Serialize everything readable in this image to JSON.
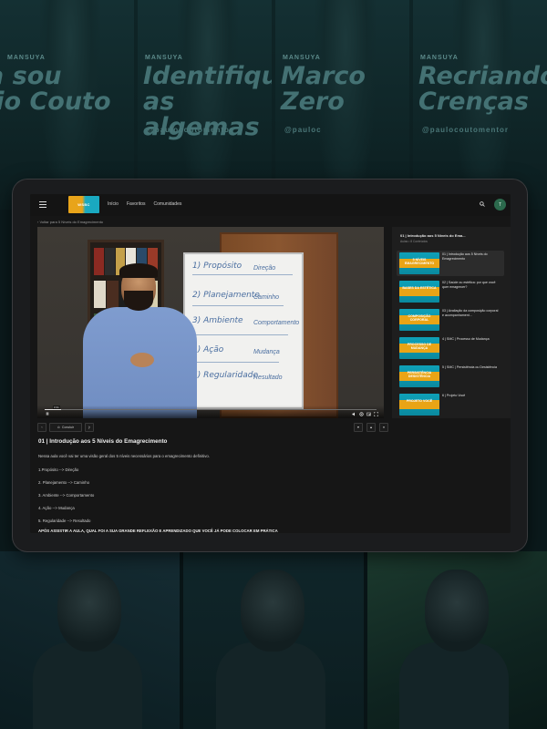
{
  "background": {
    "posters": [
      {
        "kicker": "MANSUYA",
        "title": "a sou\nlio Couto",
        "handle": ""
      },
      {
        "kicker": "MANSUYA",
        "title": "Identifique\nas algemas",
        "handle": "@paulocoutomentor"
      },
      {
        "kicker": "MANSUYA",
        "title": "Marco\nZero",
        "handle": "@pauloc"
      },
      {
        "kicker": "MANSUYA",
        "title": "Recriando\nCrenças",
        "handle": "@paulocoutomentor"
      }
    ]
  },
  "nav": {
    "logo": "WSBC",
    "links": [
      "Início",
      "Favoritos",
      "Comunidades"
    ],
    "avatar_initial": "T"
  },
  "breadcrumb": "‹ Voltar para 5 Níveis do Emagrecimento",
  "video": {
    "progress": 0.05,
    "time": "0:31",
    "board": {
      "lines": [
        "1) Propósito",
        "2) Planejamento",
        "3) Ambiente",
        "4) Ação",
        "5) Regularidade"
      ],
      "results": [
        "Direção",
        "Caminho",
        "Comportamento",
        "Mudança",
        "Resultado"
      ]
    }
  },
  "playlist": {
    "title": "01 | Introdução aos 5 Níveis do Ema...",
    "subtitle": "Aulas • 8 Conteúdos",
    "items": [
      {
        "thumb": "5 NÍVEIS\nEMAGRECIMENTO",
        "title": "01 | Introdução aos 5 Níveis do Emagrecimento",
        "active": true
      },
      {
        "thumb": "BASES DA\nESTÉTICA",
        "title": "02 | Saúde ou estética: por que você quer emagrecer?",
        "active": false
      },
      {
        "thumb": "COMPOSIÇÃO\nCORPORAL",
        "title": "03 | Avaliação da composição corporal e acompanhament...",
        "active": false
      },
      {
        "thumb": "PROCESSO DE\nMUDANÇA",
        "title": "4 | SMC | Processo de Mudança",
        "active": false
      },
      {
        "thumb": "PERSISTÊNCIA\nDESISTÊNCIA",
        "title": "5 | SMC | Persistência ou Desistência",
        "active": false
      },
      {
        "thumb": "PROJETO\nVOCÊ",
        "title": "6 | Projeto Você",
        "active": false
      }
    ]
  },
  "actions": {
    "prev": "‹",
    "complete": "Concluir",
    "next": "|‹"
  },
  "lesson": {
    "title": "01 | Introdução aos 5 Níveis do Emagrecimento",
    "description": "Nessa aula você vai ter uma visão geral dos 5 níveis necessários para o emagrecimento definitivo.",
    "items": [
      "1.Propósito --> Direção",
      "2. Planejamento --> Caminho",
      "3. Ambiente --> Comportamento",
      "4. Ação --> Mudança",
      "5. Regularidade --> Resultado"
    ],
    "cta": "APÓS ASSISTIR A AULA, QUAL FOI A SUA GRANDE REFLEXÃO E APRENDIZADO QUE VOCÊ JÁ PODE COLOCAR EM PRÁTICA"
  },
  "colors": {
    "accent_orange": "#e8a41a",
    "accent_teal": "#1aa9c0",
    "background": "#161616"
  }
}
